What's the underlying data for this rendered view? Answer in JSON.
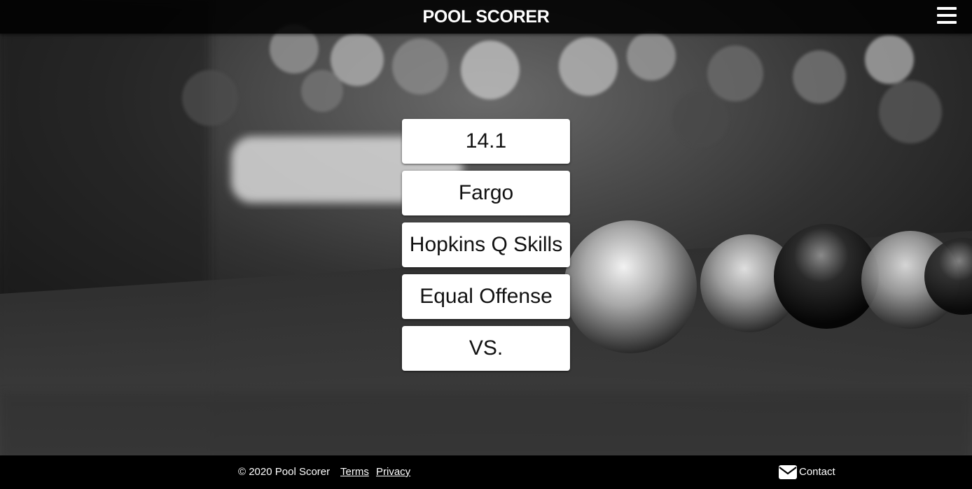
{
  "header": {
    "title": "POOL SCORER",
    "menu_icon": "hamburger-menu-icon"
  },
  "main": {
    "menu_items": [
      {
        "label": "14.1"
      },
      {
        "label": "Fargo"
      },
      {
        "label": "Hopkins Q Skills"
      },
      {
        "label": "Equal Offense"
      },
      {
        "label": "VS."
      }
    ]
  },
  "footer": {
    "copyright": "© 2020 Pool Scorer",
    "terms_label": "Terms",
    "privacy_label": "Privacy",
    "contact_label": "Contact",
    "contact_icon": "envelope-icon"
  },
  "theme": {
    "header_bg": "#000000",
    "footer_bg": "#000000",
    "button_bg": "#ffffff",
    "text_light": "#ffffff",
    "text_dark": "#111111"
  }
}
